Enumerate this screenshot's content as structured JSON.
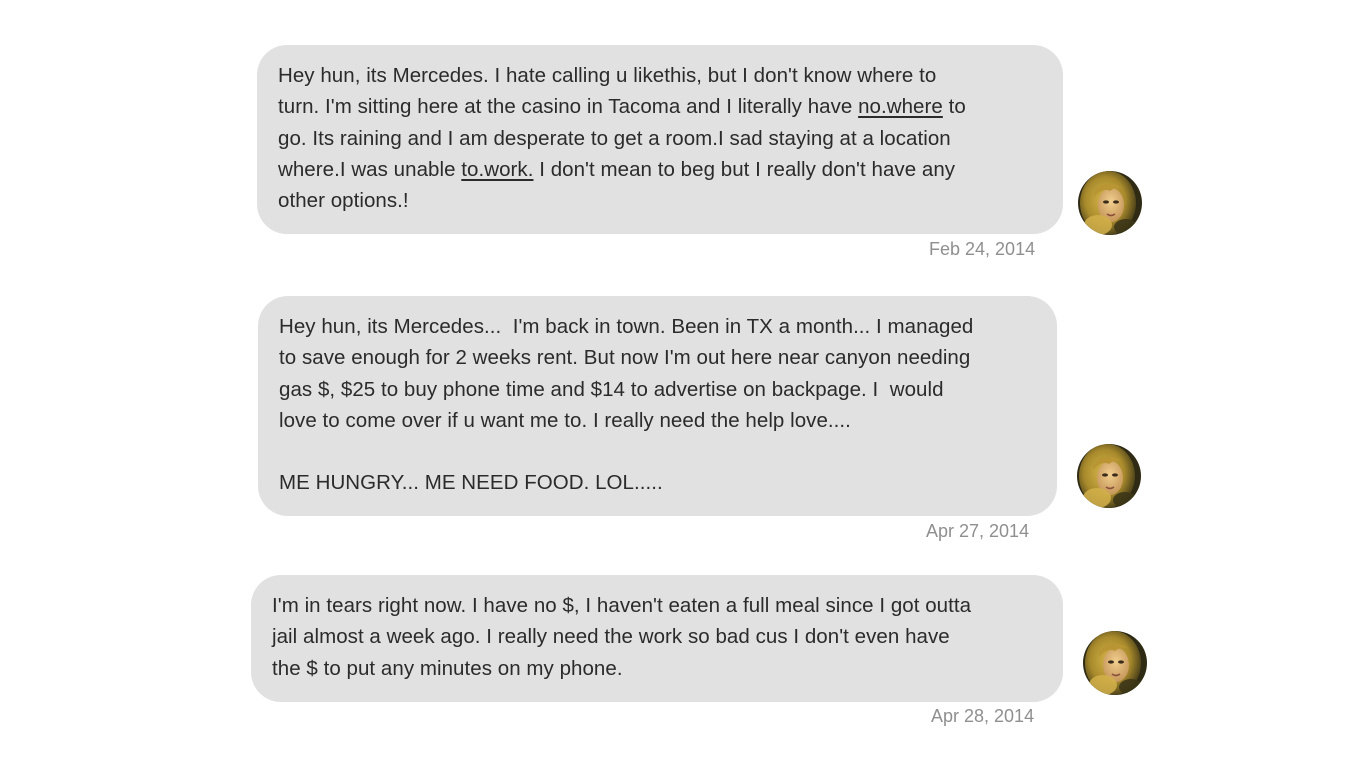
{
  "messages": [
    {
      "lines": [
        {
          "parts": [
            {
              "text": "Hey hun, its Mercedes. I hate calling u likethis, but I don't know where to"
            }
          ]
        },
        {
          "parts": [
            {
              "text": "turn. I'm sitting here at the casino in Tacoma and I literally have "
            },
            {
              "text": "no.where",
              "underline": true
            },
            {
              "text": " to"
            }
          ]
        },
        {
          "parts": [
            {
              "text": "go. Its raining and I am desperate to get a room.I sad staying at a location"
            }
          ]
        },
        {
          "parts": [
            {
              "text": "where.I was unable "
            },
            {
              "text": "to.work.",
              "underline": true
            },
            {
              "text": " I don't mean to beg but I really don't have any"
            }
          ]
        },
        {
          "parts": [
            {
              "text": "other options.!"
            }
          ]
        }
      ],
      "timestamp": "Feb 24, 2014",
      "avatar_icon": "sender-avatar-photo"
    },
    {
      "lines": [
        {
          "parts": [
            {
              "text": "Hey hun, its Mercedes...  I'm back in town. Been in TX a month... I managed"
            }
          ]
        },
        {
          "parts": [
            {
              "text": "to save enough for 2 weeks rent. But now I'm out here near canyon needing"
            }
          ]
        },
        {
          "parts": [
            {
              "text": "gas $, $25 to buy phone time and $14 to advertise on backpage. I  would"
            }
          ]
        },
        {
          "parts": [
            {
              "text": "love to come over if u want me to. I really need the help love...."
            }
          ]
        },
        {
          "parts": [
            {
              "text": ""
            }
          ]
        },
        {
          "parts": [
            {
              "text": "ME HUNGRY... ME NEED FOOD. LOL....."
            }
          ]
        }
      ],
      "timestamp": "Apr 27, 2014",
      "avatar_icon": "sender-avatar-photo"
    },
    {
      "lines": [
        {
          "parts": [
            {
              "text": "I'm in tears right now. I have no $, I haven't eaten a full meal since I got outta"
            }
          ]
        },
        {
          "parts": [
            {
              "text": "jail almost a week ago. I really need the work so bad cus I don't even have"
            }
          ]
        },
        {
          "parts": [
            {
              "text": "the $ to put any minutes on my phone."
            }
          ]
        }
      ],
      "timestamp": "Apr 28, 2014",
      "avatar_icon": "sender-avatar-photo"
    }
  ],
  "colors": {
    "bubble_background": "#e1e1e1",
    "message_text": "#2b2b2b",
    "timestamp_text": "#8f8f8f",
    "page_background": "#ffffff"
  }
}
